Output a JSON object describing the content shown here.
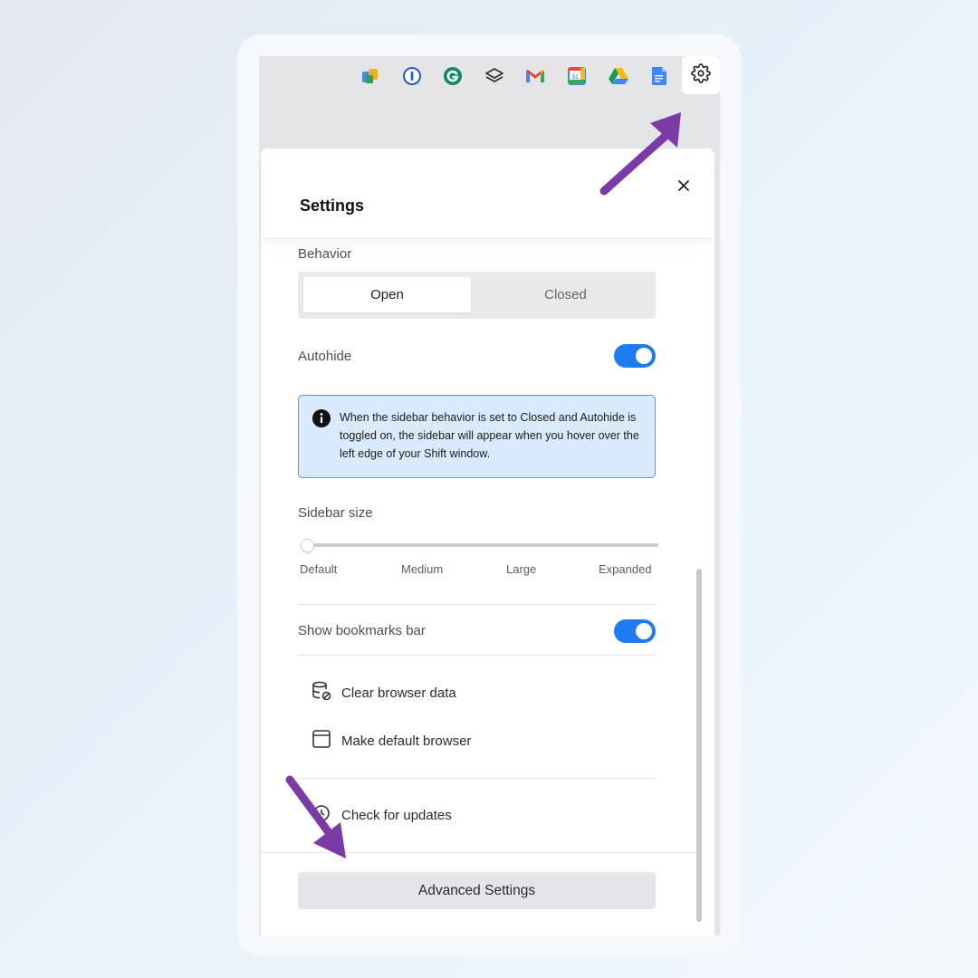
{
  "toolbar": {
    "apps": [
      {
        "icon": "office-app-icon"
      },
      {
        "icon": "1password-icon"
      },
      {
        "icon": "grammarly-icon"
      },
      {
        "icon": "layers-app-icon"
      },
      {
        "icon": "gmail-icon"
      },
      {
        "icon": "google-calendar-icon",
        "badge": "31"
      },
      {
        "icon": "google-drive-icon"
      },
      {
        "icon": "google-docs-icon"
      }
    ],
    "settings_icon": "gear-icon"
  },
  "settings": {
    "title": "Settings",
    "behavior": {
      "label": "Behavior",
      "options": [
        "Open",
        "Closed"
      ],
      "selected": "Open"
    },
    "autohide": {
      "label": "Autohide",
      "enabled": true
    },
    "info": {
      "icon": "info-icon",
      "text": "When the sidebar behavior is set to Closed and Autohide is toggled on, the sidebar will appear when you hover over the left edge of your Shift window."
    },
    "sidebar_size": {
      "label": "Sidebar size",
      "ticks": [
        "Default",
        "Medium",
        "Large",
        "Expanded"
      ],
      "selected": "Default"
    },
    "bookmarks_bar": {
      "label": "Show bookmarks bar",
      "enabled": true
    },
    "actions": {
      "clear_data": "Clear browser data",
      "default_browser": "Make default browser",
      "check_updates": "Check for updates"
    },
    "advanced_button": "Advanced Settings"
  },
  "colors": {
    "accent": "#1f7cf0",
    "info_bg": "#d9eafc",
    "annotation_arrow": "#7b3aa6"
  }
}
